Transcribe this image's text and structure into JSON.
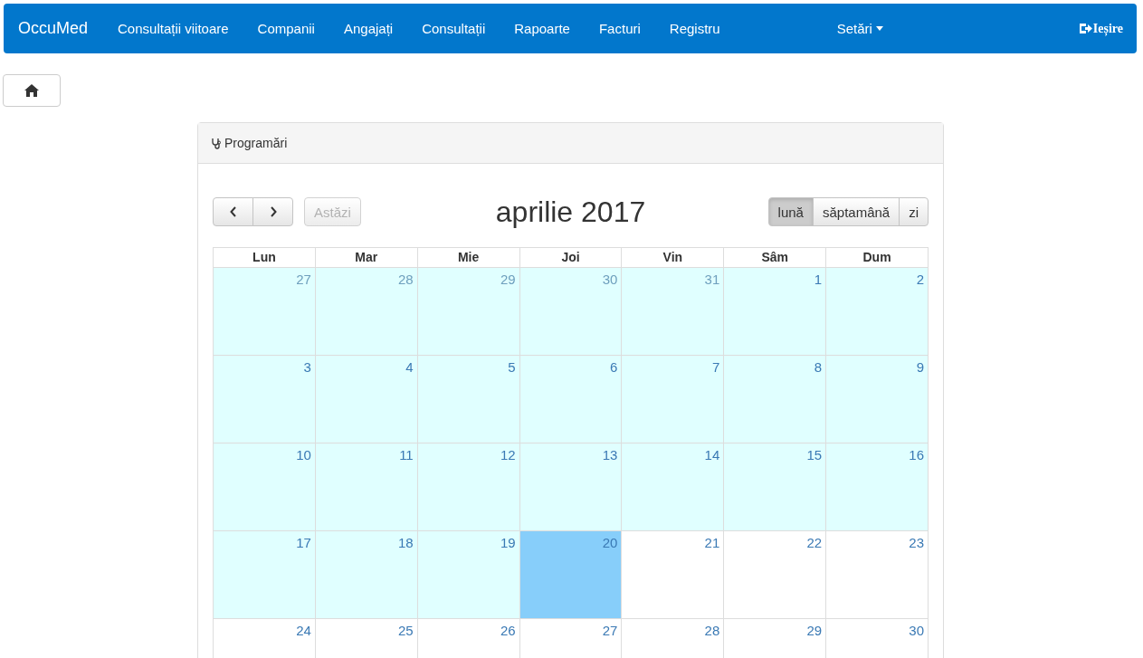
{
  "navbar": {
    "brand": "OccuMed",
    "items": [
      {
        "label": "Consultații viitoare"
      },
      {
        "label": "Companii"
      },
      {
        "label": "Angajați"
      },
      {
        "label": "Consultații"
      },
      {
        "label": "Rapoarte"
      },
      {
        "label": "Facturi"
      },
      {
        "label": "Registru"
      }
    ],
    "settings": {
      "label": "Setări"
    },
    "logout": {
      "label": "Ieșire"
    }
  },
  "panel": {
    "title": "Programări"
  },
  "calendar": {
    "title": "aprilie 2017",
    "today_button": {
      "label": "Astăzi",
      "disabled": true
    },
    "views": [
      {
        "label": "lună",
        "selected": true
      },
      {
        "label": "săptamână",
        "selected": false
      },
      {
        "label": "zi",
        "selected": false
      }
    ],
    "weekdays": [
      "Lun",
      "Mar",
      "Mie",
      "Joi",
      "Vin",
      "Sâm",
      "Dum"
    ],
    "weeks": [
      [
        {
          "day": "27",
          "faded": true,
          "kind": "past"
        },
        {
          "day": "28",
          "faded": true,
          "kind": "past"
        },
        {
          "day": "29",
          "faded": true,
          "kind": "past"
        },
        {
          "day": "30",
          "faded": true,
          "kind": "past"
        },
        {
          "day": "31",
          "faded": true,
          "kind": "past"
        },
        {
          "day": "1",
          "faded": false,
          "kind": "past"
        },
        {
          "day": "2",
          "faded": false,
          "kind": "past"
        }
      ],
      [
        {
          "day": "3",
          "faded": false,
          "kind": "past"
        },
        {
          "day": "4",
          "faded": false,
          "kind": "past"
        },
        {
          "day": "5",
          "faded": false,
          "kind": "past"
        },
        {
          "day": "6",
          "faded": false,
          "kind": "past"
        },
        {
          "day": "7",
          "faded": false,
          "kind": "past"
        },
        {
          "day": "8",
          "faded": false,
          "kind": "past"
        },
        {
          "day": "9",
          "faded": false,
          "kind": "past"
        }
      ],
      [
        {
          "day": "10",
          "faded": false,
          "kind": "past"
        },
        {
          "day": "11",
          "faded": false,
          "kind": "past"
        },
        {
          "day": "12",
          "faded": false,
          "kind": "past"
        },
        {
          "day": "13",
          "faded": false,
          "kind": "past"
        },
        {
          "day": "14",
          "faded": false,
          "kind": "past"
        },
        {
          "day": "15",
          "faded": false,
          "kind": "past"
        },
        {
          "day": "16",
          "faded": false,
          "kind": "past"
        }
      ],
      [
        {
          "day": "17",
          "faded": false,
          "kind": "past"
        },
        {
          "day": "18",
          "faded": false,
          "kind": "past"
        },
        {
          "day": "19",
          "faded": false,
          "kind": "past"
        },
        {
          "day": "20",
          "faded": false,
          "kind": "today"
        },
        {
          "day": "21",
          "faded": false,
          "kind": "future"
        },
        {
          "day": "22",
          "faded": false,
          "kind": "future"
        },
        {
          "day": "23",
          "faded": false,
          "kind": "future"
        }
      ],
      [
        {
          "day": "24",
          "faded": false,
          "kind": "future"
        },
        {
          "day": "25",
          "faded": false,
          "kind": "future"
        },
        {
          "day": "26",
          "faded": false,
          "kind": "future"
        },
        {
          "day": "27",
          "faded": false,
          "kind": "future"
        },
        {
          "day": "28",
          "faded": false,
          "kind": "future"
        },
        {
          "day": "29",
          "faded": false,
          "kind": "future"
        },
        {
          "day": "30",
          "faded": false,
          "kind": "future"
        }
      ]
    ]
  }
}
